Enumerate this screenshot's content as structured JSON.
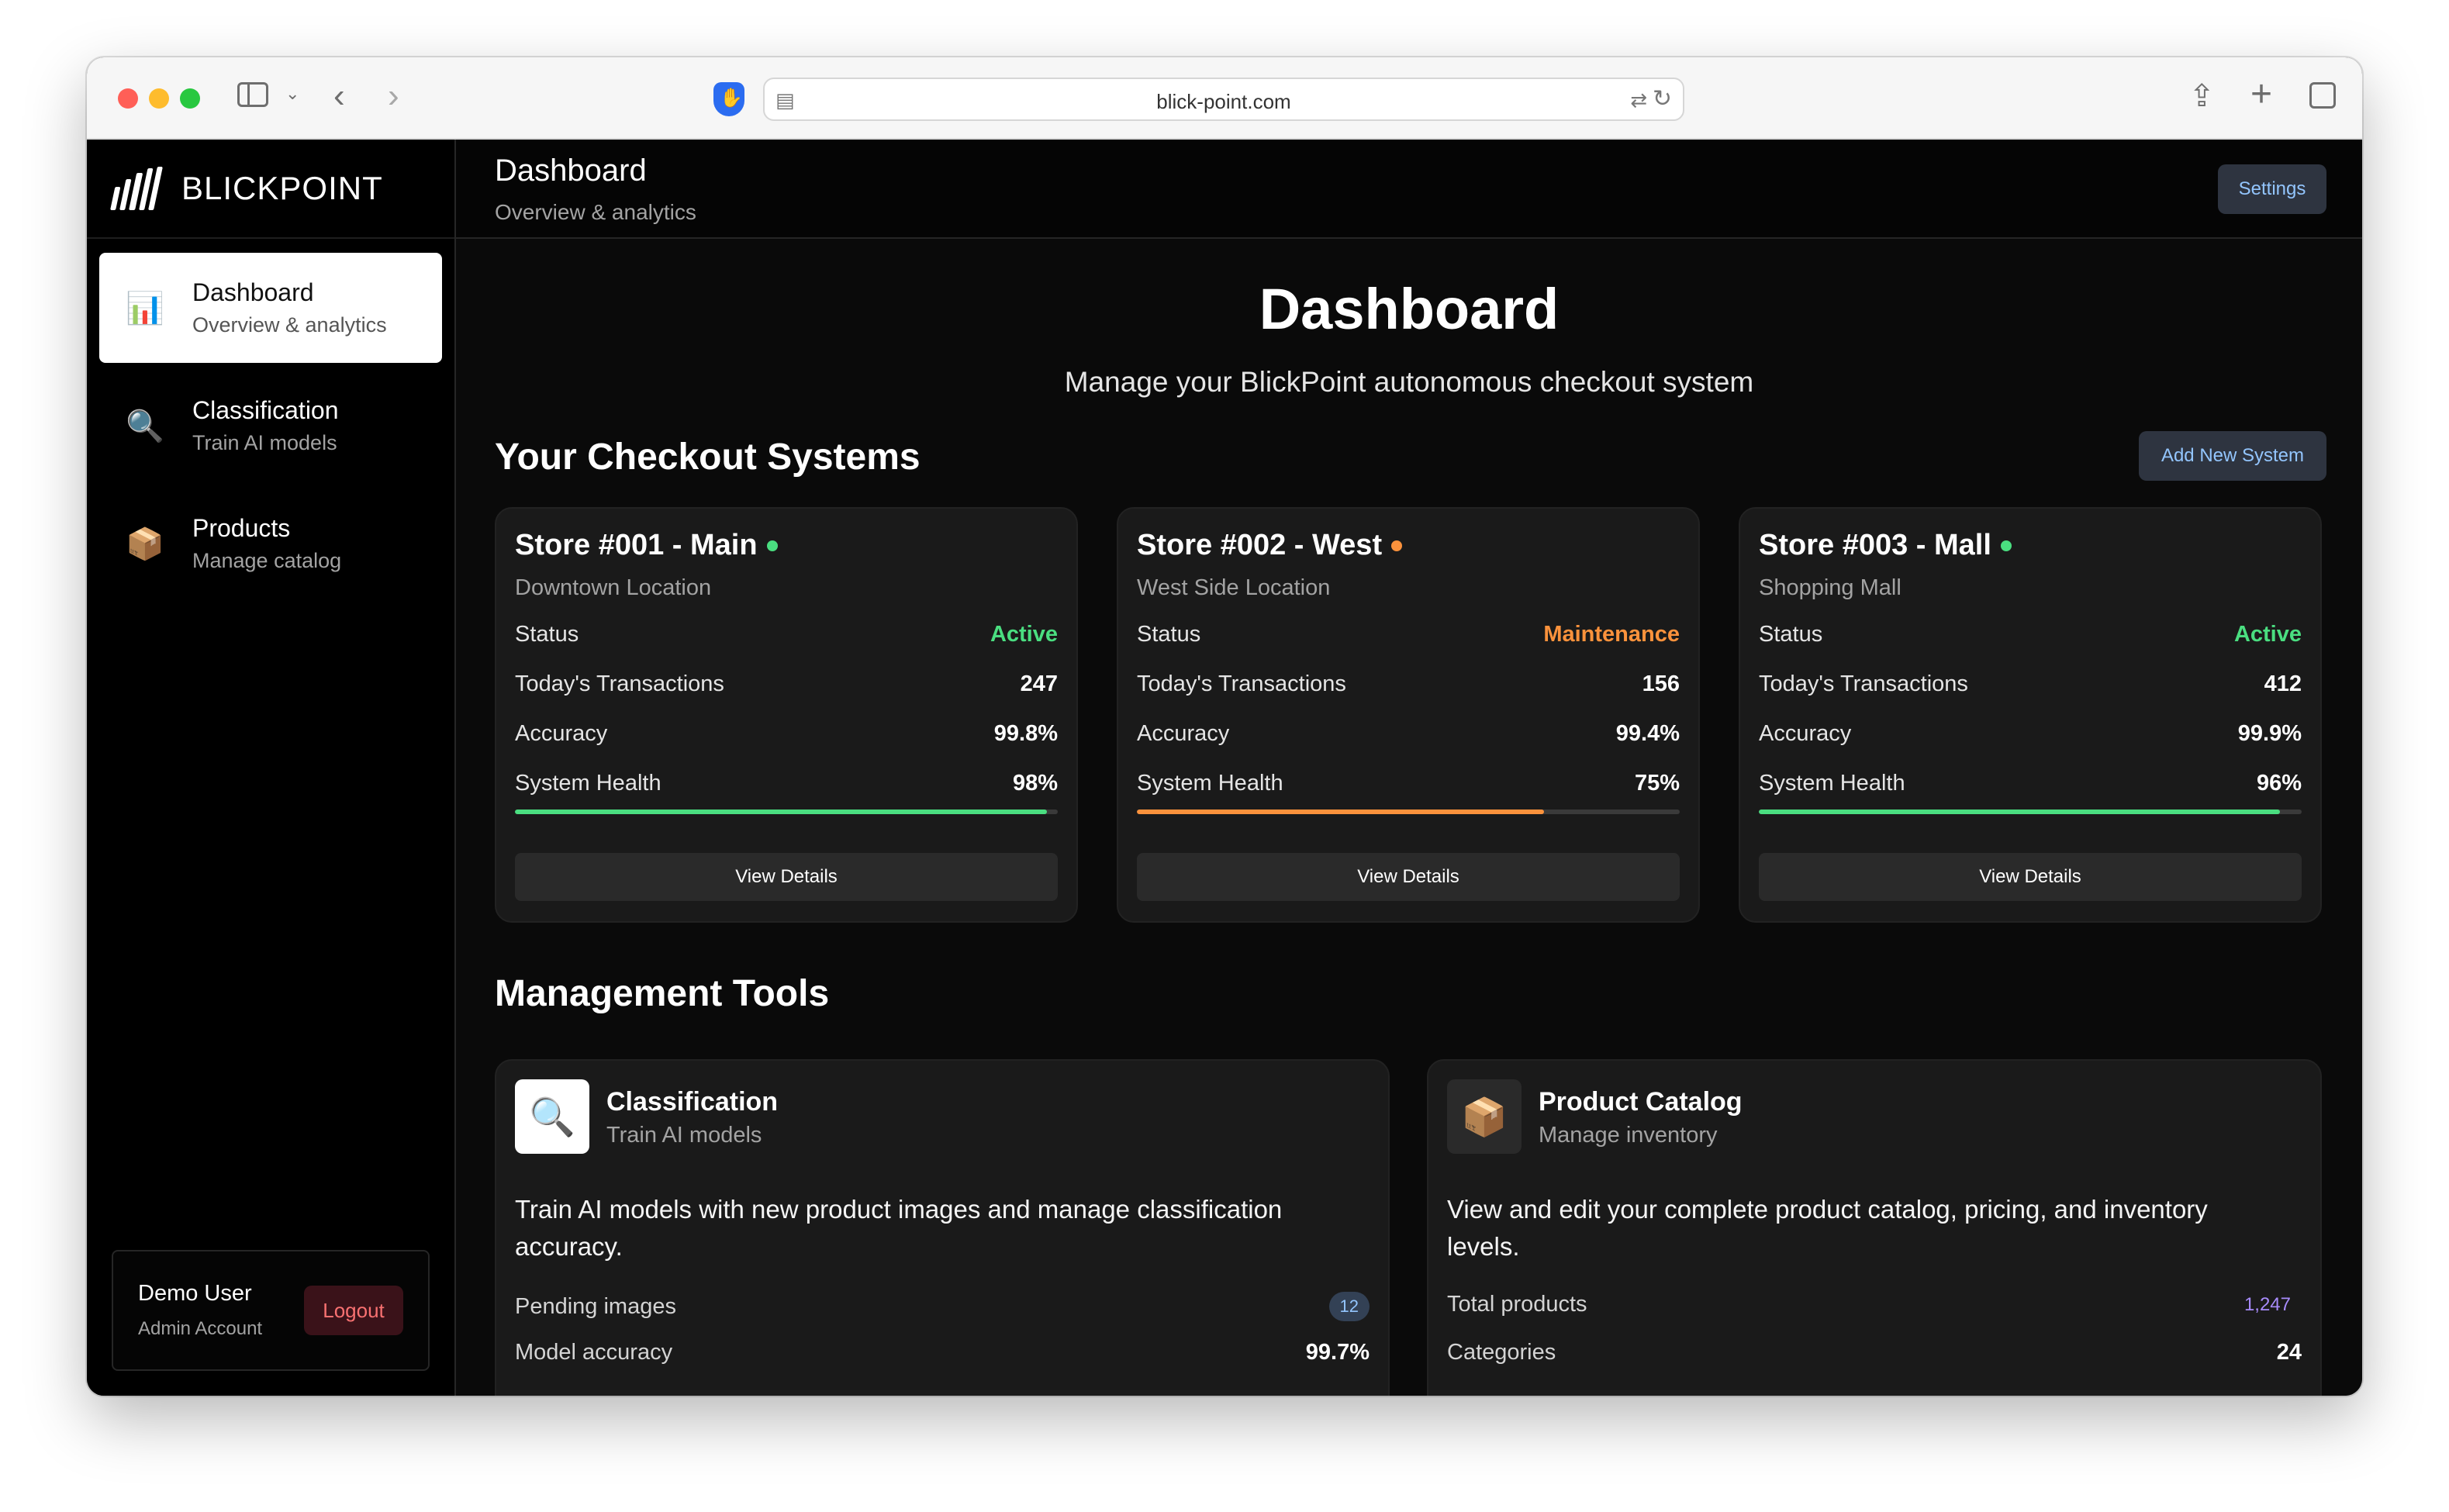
{
  "browser": {
    "url": "blick-point.com"
  },
  "sidebar": {
    "brand": "BLICKPOINT",
    "items": [
      {
        "title": "Dashboard",
        "subtitle": "Overview & analytics",
        "icon": "📊"
      },
      {
        "title": "Classification",
        "subtitle": "Train AI models",
        "icon": "🔍"
      },
      {
        "title": "Products",
        "subtitle": "Manage catalog",
        "icon": "📦"
      }
    ],
    "user": {
      "name": "Demo User",
      "role": "Admin Account",
      "logout_label": "Logout"
    }
  },
  "topbar": {
    "title": "Dashboard",
    "subtitle": "Overview & analytics",
    "settings_label": "Settings"
  },
  "hero": {
    "title": "Dashboard",
    "subtitle": "Manage your BlickPoint autonomous checkout system"
  },
  "systems": {
    "heading": "Your Checkout Systems",
    "add_label": "Add New System",
    "labels": {
      "status": "Status",
      "transactions": "Today's Transactions",
      "accuracy": "Accuracy",
      "health": "System Health",
      "view": "View Details"
    },
    "cards": [
      {
        "name": "Store #001 - Main",
        "location": "Downtown Location",
        "status": "Active",
        "status_color": "#4ade80",
        "transactions": "247",
        "accuracy": "99.8%",
        "health": "98%",
        "health_fraction": 0.98,
        "bar_color": "#4ade80"
      },
      {
        "name": "Store #002 - West",
        "location": "West Side Location",
        "status": "Maintenance",
        "status_color": "#fb923c",
        "transactions": "156",
        "accuracy": "99.4%",
        "health": "75%",
        "health_fraction": 0.75,
        "bar_color": "#fb923c"
      },
      {
        "name": "Store #003 - Mall",
        "location": "Shopping Mall",
        "status": "Active",
        "status_color": "#4ade80",
        "transactions": "412",
        "accuracy": "99.9%",
        "health": "96%",
        "health_fraction": 0.96,
        "bar_color": "#4ade80"
      }
    ]
  },
  "tools": {
    "heading": "Management Tools",
    "items": [
      {
        "title": "Classification",
        "subtitle": "Train AI models",
        "icon": "🔍",
        "description": "Train AI models with new product images and manage classification accuracy.",
        "stat1_label": "Pending images",
        "stat1_value": "12",
        "stat2_label": "Model accuracy",
        "stat2_value": "99.7%"
      },
      {
        "title": "Product Catalog",
        "subtitle": "Manage inventory",
        "icon": "📦",
        "description": "View and edit your complete product catalog, pricing, and inventory levels.",
        "stat1_label": "Total products",
        "stat1_value": "1,247",
        "stat2_label": "Categories",
        "stat2_value": "24"
      }
    ]
  }
}
